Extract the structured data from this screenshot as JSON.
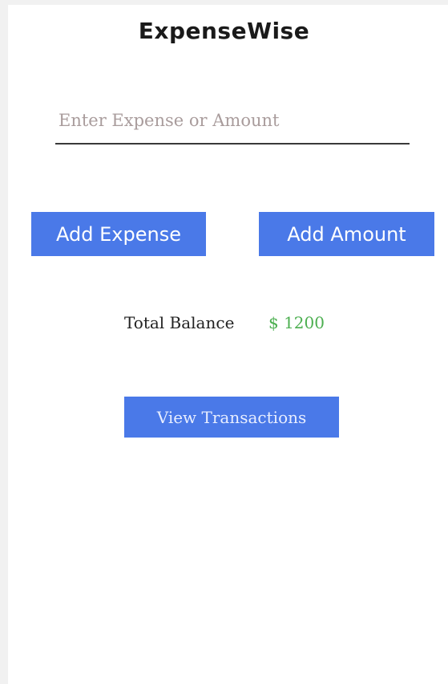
{
  "app": {
    "title": "ExpenseWise"
  },
  "input": {
    "placeholder": "Enter Expense or Amount",
    "value": ""
  },
  "buttons": {
    "add_expense": "Add Expense",
    "add_amount": "Add Amount",
    "view_transactions": "View Transactions"
  },
  "balance": {
    "label": "Total Balance",
    "value": "$ 1200"
  },
  "colors": {
    "button_bg": "#4a79e8",
    "balance_value": "#4caf50",
    "placeholder": "#a99c9c"
  }
}
